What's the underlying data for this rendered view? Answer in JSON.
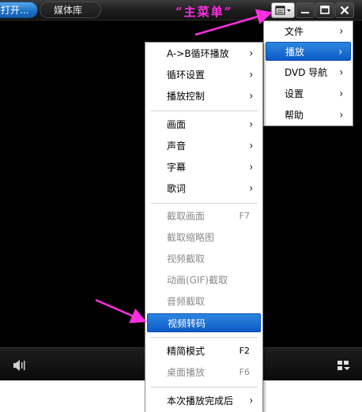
{
  "titlebar": {
    "tabs": [
      {
        "label": "打开..."
      },
      {
        "label": "媒体库"
      }
    ],
    "annotation": "“主菜单”"
  },
  "main_menu": {
    "items": [
      {
        "label": "文件",
        "arrow": "›"
      },
      {
        "label": "播放",
        "arrow": "›"
      },
      {
        "label": "DVD 导航",
        "arrow": "›"
      },
      {
        "label": "设置",
        "arrow": "›"
      },
      {
        "label": "帮助",
        "arrow": "›"
      }
    ]
  },
  "sub_menu": {
    "items": [
      {
        "label": "A->B循环播放",
        "arrow": "›"
      },
      {
        "label": "循环设置",
        "arrow": "›"
      },
      {
        "label": "播放控制",
        "arrow": "›"
      },
      {
        "label": "画面",
        "arrow": "›"
      },
      {
        "label": "声音",
        "arrow": "›"
      },
      {
        "label": "字幕",
        "arrow": "›"
      },
      {
        "label": "歌词",
        "arrow": "›"
      },
      {
        "label": "截取画面",
        "shortcut": "F7"
      },
      {
        "label": "截取缩略图"
      },
      {
        "label": "视频截取"
      },
      {
        "label": "动画(GIF)截取"
      },
      {
        "label": "音频截取"
      },
      {
        "label": "视频转码"
      },
      {
        "label": "精简模式",
        "shortcut": "F2"
      },
      {
        "label": "桌面播放",
        "shortcut": "F6"
      },
      {
        "label": "本次播放完成后",
        "arrow": "›"
      }
    ]
  },
  "colors": {
    "annotation": "#ff2fe0",
    "highlight": "#1a6fd6",
    "disabled": "#8c8c8c"
  }
}
